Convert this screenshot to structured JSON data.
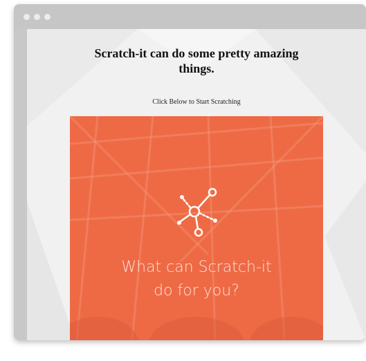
{
  "window": {
    "controls": [
      "dot",
      "dot",
      "dot"
    ]
  },
  "page": {
    "headline": "Scratch-it can do some pretty amazing things.",
    "instruction": "Click Below to Start Scratching"
  },
  "card": {
    "line1": "What can Scratch-it",
    "line2": "do for you?",
    "icon": "network-nodes-icon",
    "background_color": "#ee6a45"
  }
}
